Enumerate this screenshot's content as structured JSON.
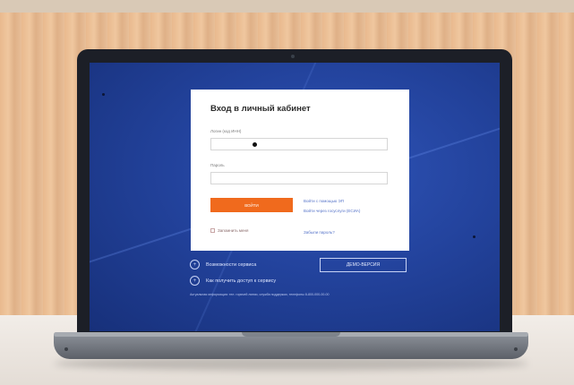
{
  "login": {
    "title": "Вход в личный кабинет",
    "login_label": "Логин (код ИНН)",
    "login_value": "",
    "password_label": "Пароль",
    "password_value": "",
    "submit_label": "ВОЙТИ",
    "link_1": "Войти с помощью ЭП",
    "link_2": "Войти через госуслуги (ЕСИА)",
    "link_3": "Забыли пароль?",
    "remember_label": "Запомнить меня"
  },
  "features": [
    {
      "icon": "circle-icon",
      "label": "Возможности сервиса"
    },
    {
      "icon": "circle-icon",
      "label": "Как получить доступ к сервису"
    }
  ],
  "demo_button": "ДЕМО-ВЕРСИЯ",
  "footer_note": "Актуальная информация: тел. горячей линии, служба поддержки, телефоны 8-800-000-00-00",
  "colors": {
    "accent": "#f06a1d",
    "screen_bg": "#23439d",
    "link": "#5573c8"
  }
}
